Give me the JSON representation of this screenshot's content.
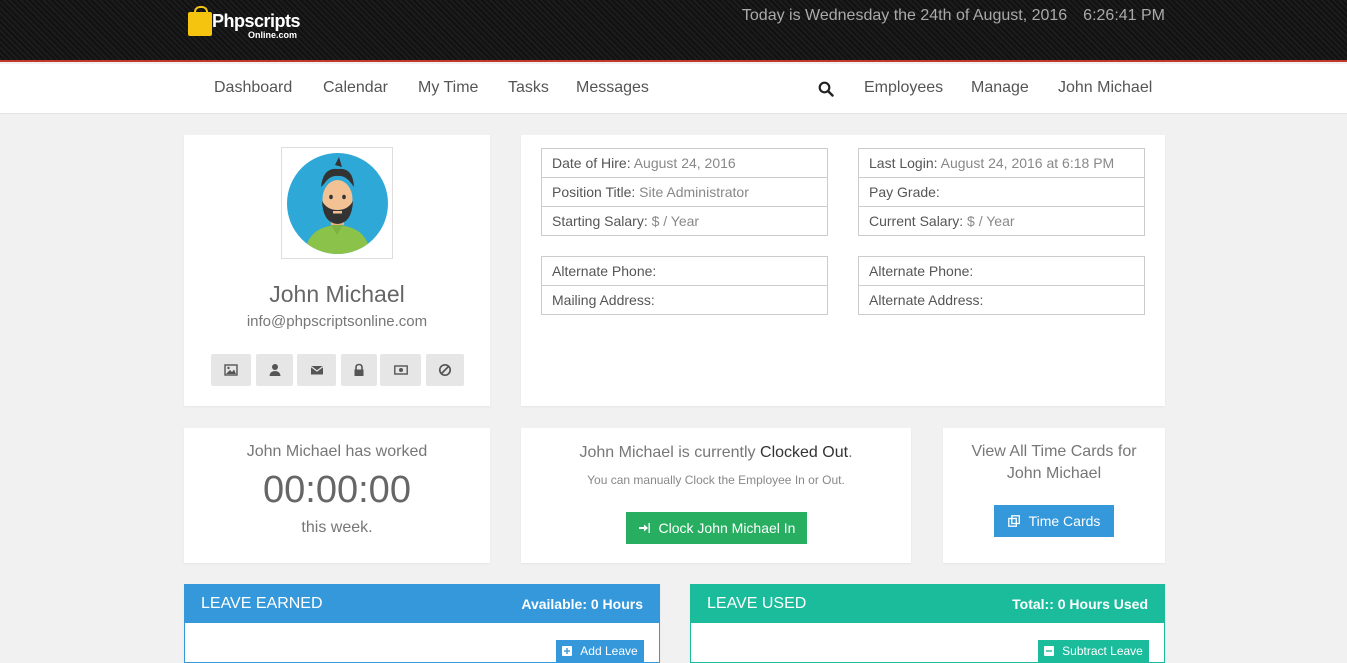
{
  "brand": {
    "line1": "Phpscripts",
    "line2": "Online.com",
    "color": "#f5c40f"
  },
  "header": {
    "date_text": "Today is Wednesday the 24th of August, 2016",
    "time_text": "6:26:41 PM"
  },
  "nav": {
    "left": [
      "Dashboard",
      "Calendar",
      "My Time",
      "Tasks",
      "Messages"
    ],
    "right": [
      "Employees",
      "Manage",
      "John Michael"
    ],
    "search_icon": "search-icon"
  },
  "profile": {
    "name": "John Michael",
    "email": "info@phpscriptsonline.com",
    "actions": [
      "image-icon",
      "user-icon",
      "envelope-icon",
      "lock-icon",
      "money-icon",
      "ban-icon"
    ]
  },
  "details": {
    "date_of_hire": {
      "label": "Date of Hire:",
      "value": "August 24, 2016"
    },
    "position_title": {
      "label": "Position Title:",
      "value": "Site Administrator"
    },
    "starting_salary": {
      "label": "Starting Salary:",
      "value": "$ / Year"
    },
    "last_login": {
      "label": "Last Login:",
      "value": "August 24, 2016 at 6:18 PM"
    },
    "pay_grade": {
      "label": "Pay Grade:",
      "value": ""
    },
    "current_salary": {
      "label": "Current Salary:",
      "value": "$ / Year"
    },
    "alt_phone_left": {
      "label": "Alternate Phone:",
      "value": ""
    },
    "mailing_address": {
      "label": "Mailing Address:",
      "value": ""
    },
    "alt_phone_right": {
      "label": "Alternate Phone:",
      "value": ""
    },
    "alt_address": {
      "label": "Alternate Address:",
      "value": ""
    }
  },
  "worked": {
    "heading": "John Michael has worked",
    "time": "00:00:00",
    "suffix": "this week."
  },
  "clock": {
    "status_prefix": "John Michael is currently",
    "status": "Clocked Out",
    "status_suffix": ".",
    "note": "You can manually Clock the Employee In or Out.",
    "button": "Clock John Michael In",
    "button_color": "#27ae60"
  },
  "timecards": {
    "line1": "View All Time Cards for",
    "line2": "John Michael",
    "button": "Time Cards",
    "button_color": "#3498db"
  },
  "leave_earned": {
    "title": "LEAVE EARNED",
    "summary": "Available: 0 Hours",
    "button": "Add Leave",
    "color": "#3498db"
  },
  "leave_used": {
    "title": "LEAVE USED",
    "summary": "Total:: 0 Hours Used",
    "button": "Subtract Leave",
    "color": "#1abc9c"
  }
}
